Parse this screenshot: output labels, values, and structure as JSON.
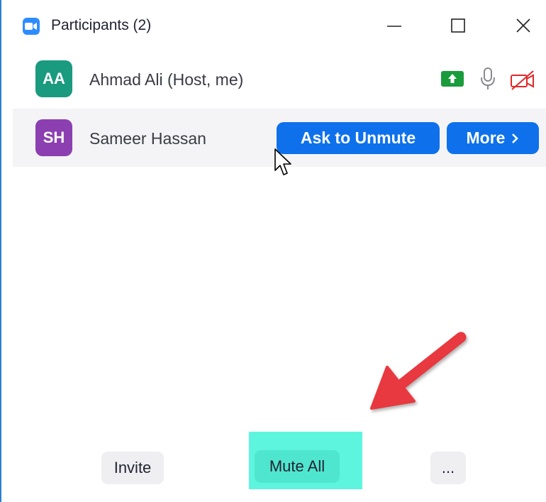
{
  "window": {
    "title": "Participants (2)",
    "app_icon": "zoom-camera-icon",
    "controls": [
      "minimize-icon",
      "maximize-icon",
      "close-icon"
    ]
  },
  "participants": [
    {
      "initials": "AA",
      "name": "Ahmad Ali (Host, me)",
      "avatar_color": "#1a9a7f",
      "status_icons": [
        "screen-share-icon",
        "microphone-icon",
        "video-off-icon"
      ]
    },
    {
      "initials": "SH",
      "name": "Sameer Hassan",
      "avatar_color": "#8c3fb0",
      "actions": {
        "ask_to_unmute": "Ask to Unmute",
        "more": "More",
        "more_icon": "chevron-right-icon"
      }
    }
  ],
  "footer": {
    "invite": "Invite",
    "mute_all": "Mute All",
    "more_options": "..."
  },
  "colors": {
    "primary_blue": "#0e71eb",
    "highlight": "#5ef5df",
    "annotation_red": "#e8393f",
    "share_green": "#1a9c3c",
    "video_off_red": "#e02828"
  }
}
